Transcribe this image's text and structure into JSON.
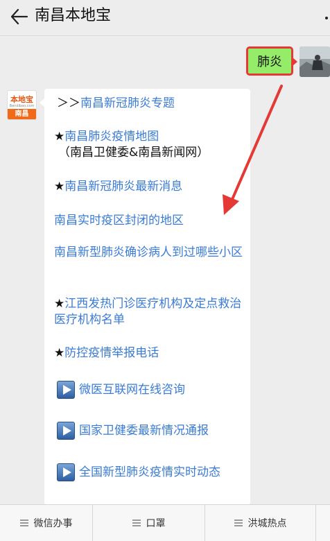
{
  "header": {
    "title": "南昌本地宝",
    "back_icon": "arrow-left-icon",
    "more_icon": "more-dots-icon"
  },
  "outgoing_message": {
    "text": "肺炎",
    "highlight_color": "#e53935",
    "bubble_color": "#95ec69"
  },
  "bot": {
    "avatar_logo": "本地宝",
    "avatar_sub": "Bendibao.com",
    "avatar_city": "南昌"
  },
  "card": {
    "topic_prefix": "＞＞",
    "topic_link": "南昌新冠肺炎专题",
    "star": "★",
    "item_map_link": "南昌肺炎疫情地图",
    "item_map_note": "（南昌卫健委&南昌新闻网）",
    "item_news_link": "南昌新冠肺炎最新消息",
    "item_closed_link": "南昌实时疫区封闭的地区",
    "item_community_link": "南昌新型肺炎确诊病人到过哪些小区",
    "item_clinic_link": "江西发热门诊医疗机构及定点救治医疗机构名单",
    "item_hotline_link": "防控疫情举报电话",
    "play_items": [
      "微医互联网在线咨询",
      "国家卫健委最新情况通报",
      "全国新型肺炎疫情实时动态"
    ]
  },
  "bottom_menu": [
    {
      "label": "微信办事",
      "icon": "menu-lines-icon"
    },
    {
      "label": "口罩",
      "icon": "menu-lines-icon"
    },
    {
      "label": "洪城热点",
      "icon": "menu-lines-icon"
    }
  ],
  "colors": {
    "link": "#3a7bd5",
    "background": "#ededed",
    "arrow": "#e53935"
  }
}
